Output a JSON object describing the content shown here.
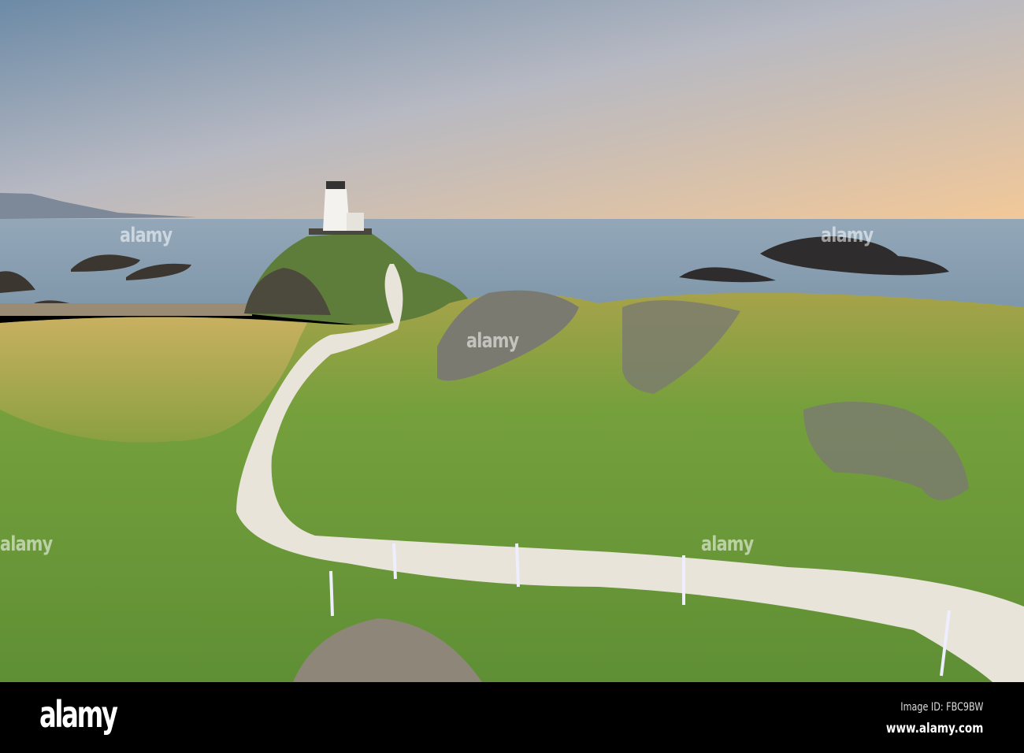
{
  "watermark": {
    "logo": "alamy",
    "repeat_text": "alamy"
  },
  "footer": {
    "logo": "alamy",
    "image_id": "Image ID: FBC9BW",
    "site": "www.alamy.com"
  },
  "colors": {
    "sky_top": "#6f8ea8",
    "sky_horizon": "#eec9a0",
    "sea": "#8ea3b4",
    "grass": "#6f9a3a",
    "path": "#e8e4da"
  }
}
